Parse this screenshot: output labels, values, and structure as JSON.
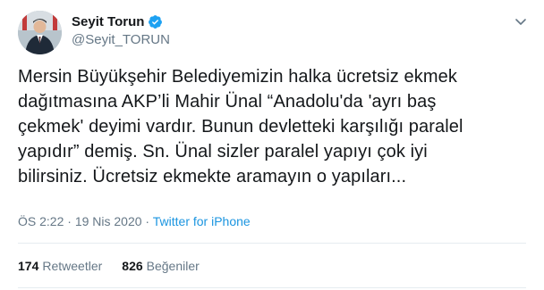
{
  "author": {
    "name": "Seyit Torun",
    "handle": "@Seyit_TORUN",
    "verified_color": "#1da1f2"
  },
  "tweet": {
    "lines": [
      "Mersin Büyükşehir Belediyemizin halka ücretsiz ekmek",
      "dağıtmasına AKP’li Mahir Ünal “Anadolu'da 'ayrı baş",
      "çekmek' deyimi vardır. Bunun devletteki karşılığı paralel",
      "yapıdır” demiş. Sn. Ünal sizler paralel yapıyı çok iyi",
      "bilirsiniz. Ücretsiz ekmekte aramayın o yapıları..."
    ]
  },
  "meta": {
    "time": "ÖS 2:22",
    "separator1": " · ",
    "date": "19 Nis 2020",
    "separator2": " · ",
    "source": "Twitter for iPhone"
  },
  "stats": {
    "retweets_count": "174",
    "retweets_label": "Retweetler",
    "likes_count": "826",
    "likes_label": "Beğeniler"
  },
  "icons": {
    "verified": "verified-badge-icon",
    "caret": "chevron-down-icon"
  },
  "colors": {
    "text": "#14171a",
    "muted": "#657786",
    "link": "#1b95e0",
    "divider": "#e6ecf0"
  }
}
